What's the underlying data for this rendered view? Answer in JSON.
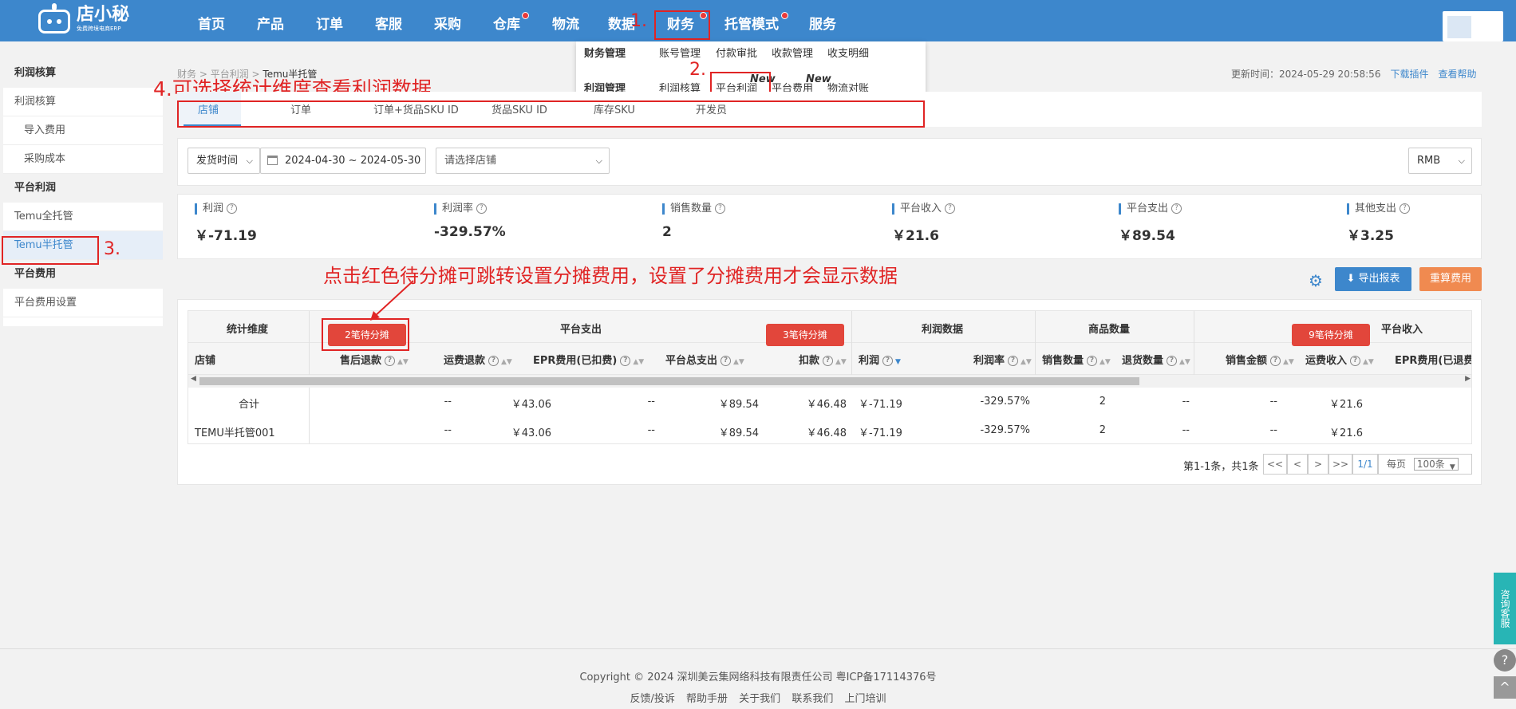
{
  "logo": {
    "main": "店小秘",
    "sub": "免费跨境电商ERP"
  },
  "nav": [
    "首页",
    "产品",
    "订单",
    "客服",
    "采购",
    "仓库",
    "物流",
    "数据",
    "财务",
    "托管模式",
    "服务"
  ],
  "dropdown": {
    "row1": [
      "财务管理",
      "账号管理",
      "付款审批",
      "收款管理",
      "收支明细"
    ],
    "row2": [
      "利润管理",
      "利润核算",
      "平台利润",
      "平台费用",
      "物流对账"
    ],
    "new": "New"
  },
  "annotations": {
    "a1": "1.",
    "a2": "2.",
    "a3": "3.",
    "a4": "4.可选择统计维度查看利润数据",
    "a5": "点击红色待分摊可跳转设置分摊费用，设置了分摊费用才会显示数据"
  },
  "sidebar": [
    {
      "type": "h",
      "label": "利润核算"
    },
    {
      "type": "i",
      "label": "利润核算"
    },
    {
      "type": "s",
      "label": "导入费用"
    },
    {
      "type": "s",
      "label": "采购成本"
    },
    {
      "type": "h",
      "label": "平台利润"
    },
    {
      "type": "i",
      "label": "Temu全托管"
    },
    {
      "type": "a",
      "label": "Temu半托管"
    },
    {
      "type": "h",
      "label": "平台费用"
    },
    {
      "type": "i",
      "label": "平台费用设置"
    }
  ],
  "breadcrumb": {
    "p1": "财务",
    "p2": "平台利润",
    "current": "Temu半托管"
  },
  "update": {
    "text": "更新时间：2024-05-29 20:58:56",
    "plugin": "下载插件",
    "help": "查看帮助"
  },
  "tabs": [
    "店铺",
    "订单",
    "订单+货品SKU ID",
    "货品SKU ID",
    "库存SKU",
    "开发员"
  ],
  "filters": {
    "time_type": "发货时间",
    "date_range": "2024-04-30 ~ 2024-05-30",
    "shop_placeholder": "请选择店铺",
    "currency": "RMB"
  },
  "kpis": [
    {
      "label": "利润",
      "value": "￥-71.19"
    },
    {
      "label": "利润率",
      "value": "-329.57%"
    },
    {
      "label": "销售数量",
      "value": "2"
    },
    {
      "label": "平台收入",
      "value": "￥21.6"
    },
    {
      "label": "平台支出",
      "value": "￥89.54"
    },
    {
      "label": "其他支出",
      "value": "￥3.25"
    }
  ],
  "buttons": {
    "export": "导出报表",
    "recalc": "重算费用"
  },
  "table": {
    "groups": [
      "统计维度",
      "平台支出",
      "利润数据",
      "商品数量",
      "平台收入"
    ],
    "pending": [
      "2笔待分摊",
      "3笔待分摊",
      "9笔待分摊"
    ],
    "columns": [
      "店铺",
      "售后退款",
      "运费退款",
      "EPR费用(已扣费)",
      "平台总支出",
      "扣款",
      "利润",
      "利润率",
      "销售数量",
      "退货数量",
      "销售金额",
      "运费收入",
      "EPR费用(已退费"
    ],
    "rows": [
      [
        "合计",
        "--",
        "￥43.06",
        "--",
        "￥89.54",
        "￥46.48",
        "￥-71.19",
        "-329.57%",
        "2",
        "--",
        "--",
        "￥21.6"
      ],
      [
        "TEMU半托管001",
        "--",
        "￥43.06",
        "--",
        "￥89.54",
        "￥46.48",
        "￥-71.19",
        "-329.57%",
        "2",
        "--",
        "--",
        "￥21.6"
      ]
    ]
  },
  "pager": {
    "summary": "第1-1条，共1条",
    "first": "<<",
    "prev": "<",
    "next": ">",
    "last": ">>",
    "page": "1/1",
    "per_label": "每页",
    "per_value": "100条"
  },
  "footer": {
    "copyright": "Copyright © 2024 深圳美云集网络科技有限责任公司  粤ICP备17114376号",
    "links": [
      "反馈/投诉",
      "帮助手册",
      "关于我们",
      "联系我们",
      "上门培训"
    ]
  },
  "float": {
    "service": "咨询客服",
    "help": "?",
    "top": "^"
  }
}
